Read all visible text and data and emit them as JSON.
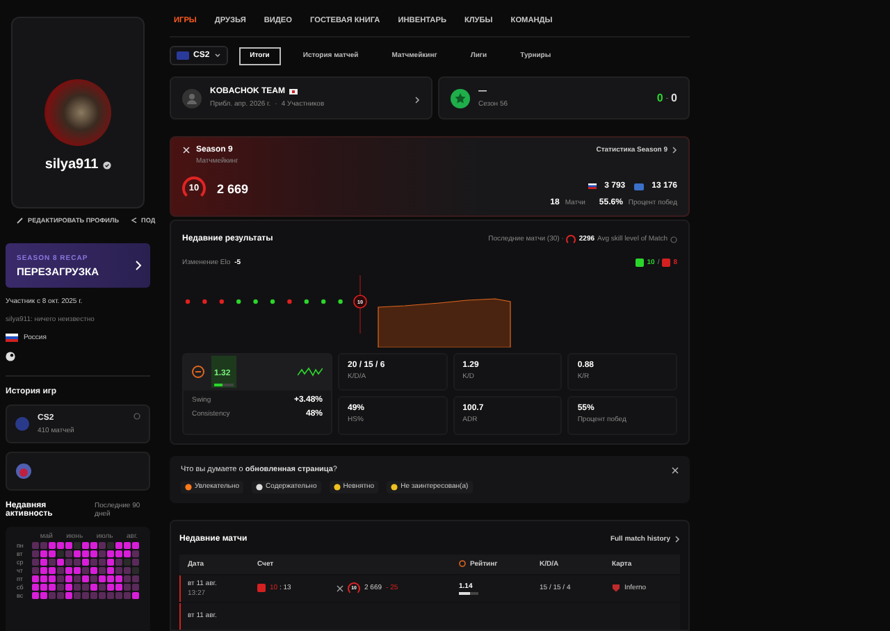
{
  "sidebar": {
    "username": "silya911",
    "actions": [
      {
        "kind": "edit",
        "label": "РЕДАКТИРОВАТЬ ПРОФИЛЬ"
      },
      {
        "kind": "share",
        "label": "ПОД"
      }
    ],
    "recap": {
      "kicker": "SEASON 8 RECAP",
      "title": "ПЕРЕЗАГРУЗКА"
    },
    "member_since": "Участник с 8 окт. 2025 г.",
    "about": "silya911: ничего неизвестно",
    "country": "Россия",
    "history_title": "История игр",
    "games": [
      {
        "name": "CS2",
        "matches": "410 матчей"
      }
    ],
    "activity": {
      "title": "Недавняя активность",
      "period": "Последние 90 дней",
      "months": [
        "май",
        "июнь",
        "июль",
        "авг."
      ],
      "days": [
        {
          "label": "пн",
          "cells": [
            {
              "color": "#5a2a5a"
            },
            {
              "color": "#5a2a5a"
            },
            {
              "color": "#d81ed8"
            },
            {
              "color": "#d81ed8"
            },
            {
              "color": "#d81ed8"
            },
            {
              "color": "#2a2a2a"
            },
            {
              "color": "#d81ed8"
            },
            {
              "color": "#d81ed8"
            },
            {
              "color": "#5a2a5a"
            },
            {
              "color": "#2a2a2a"
            },
            {
              "color": "#d81ed8"
            },
            {
              "color": "#d81ed8"
            },
            {
              "color": "#d81ed8"
            }
          ]
        },
        {
          "label": "вт",
          "cells": [
            {
              "color": "#5a2a5a"
            },
            {
              "color": "#d81ed8"
            },
            {
              "color": "#d81ed8"
            },
            {
              "color": "#2a2a2a"
            },
            {
              "color": "#5a2a5a"
            },
            {
              "color": "#d81ed8"
            },
            {
              "color": "#d81ed8"
            },
            {
              "color": "#d81ed8"
            },
            {
              "color": "#5a2a5a"
            },
            {
              "color": "#d81ed8"
            },
            {
              "color": "#d81ed8"
            },
            {
              "color": "#d81ed8"
            },
            {
              "color": "#5a2a5a"
            }
          ]
        },
        {
          "label": "ср",
          "cells": [
            {
              "color": "#5a2a5a"
            },
            {
              "color": "#d81ed8"
            },
            {
              "color": "#5a2a5a"
            },
            {
              "color": "#d81ed8"
            },
            {
              "color": "#5a2a5a"
            },
            {
              "color": "#5a2a5a"
            },
            {
              "color": "#d81ed8"
            },
            {
              "color": "#5a2a5a"
            },
            {
              "color": "#5a2a5a"
            },
            {
              "color": "#d81ed8"
            },
            {
              "color": "#5a2a5a"
            },
            {
              "color": "#2a2a2a"
            },
            {
              "color": "#5a2a5a"
            }
          ]
        },
        {
          "label": "чт",
          "cells": [
            {
              "color": "#5a2a5a"
            },
            {
              "color": "#d81ed8"
            },
            {
              "color": "#d81ed8"
            },
            {
              "color": "#5a2a5a"
            },
            {
              "color": "#d81ed8"
            },
            {
              "color": "#d81ed8"
            },
            {
              "color": "#5a2a5a"
            },
            {
              "color": "#d81ed8"
            },
            {
              "color": "#5a2a5a"
            },
            {
              "color": "#d81ed8"
            },
            {
              "color": "#5a2a5a"
            },
            {
              "color": "#5a2a5a"
            },
            {
              "color": "#2a2a2a"
            }
          ]
        },
        {
          "label": "пт",
          "cells": [
            {
              "color": "#d81ed8"
            },
            {
              "color": "#d81ed8"
            },
            {
              "color": "#d81ed8"
            },
            {
              "color": "#5a2a5a"
            },
            {
              "color": "#d81ed8"
            },
            {
              "color": "#5a2a5a"
            },
            {
              "color": "#d81ed8"
            },
            {
              "color": "#5a2a5a"
            },
            {
              "color": "#d81ed8"
            },
            {
              "color": "#d81ed8"
            },
            {
              "color": "#d81ed8"
            },
            {
              "color": "#5a2a5a"
            },
            {
              "color": "#5a2a5a"
            }
          ]
        },
        {
          "label": "сб",
          "cells": [
            {
              "color": "#d81ed8"
            },
            {
              "color": "#d81ed8"
            },
            {
              "color": "#d81ed8"
            },
            {
              "color": "#5a2a5a"
            },
            {
              "color": "#d81ed8"
            },
            {
              "color": "#5a2a5a"
            },
            {
              "color": "#5a2a5a"
            },
            {
              "color": "#d81ed8"
            },
            {
              "color": "#5a2a5a"
            },
            {
              "color": "#d81ed8"
            },
            {
              "color": "#d81ed8"
            },
            {
              "color": "#5a2a5a"
            },
            {
              "color": "#5a2a5a"
            }
          ]
        },
        {
          "label": "вс",
          "cells": [
            {
              "color": "#d81ed8"
            },
            {
              "color": "#d81ed8"
            },
            {
              "color": "#5a2a5a"
            },
            {
              "color": "#5a2a5a"
            },
            {
              "color": "#d81ed8"
            },
            {
              "color": "#5a2a5a"
            },
            {
              "color": "#5a2a5a"
            },
            {
              "color": "#5a2a5a"
            },
            {
              "color": "#5a2a5a"
            },
            {
              "color": "#5a2a5a"
            },
            {
              "color": "#5a2a5a"
            },
            {
              "color": "#5a2a5a"
            },
            {
              "color": "#d81ed8"
            }
          ]
        }
      ]
    }
  },
  "nav": [
    {
      "label": "ИГРЫ",
      "selected": true
    },
    {
      "label": "ДРУЗЬЯ",
      "selected": false
    },
    {
      "label": "ВИДЕО",
      "selected": false
    },
    {
      "label": "ГОСТЕВАЯ КНИГА",
      "selected": false
    },
    {
      "label": "ИНВЕНТАРЬ",
      "selected": false
    },
    {
      "label": "КЛУБЫ",
      "selected": false
    },
    {
      "label": "КОМАНДЫ",
      "selected": false
    }
  ],
  "game_select": {
    "value": "CS2"
  },
  "subtabs": [
    {
      "label": "Итоги",
      "selected": true
    },
    {
      "label": "История матчей",
      "selected": false
    },
    {
      "label": "Матчмейкинг",
      "selected": false
    },
    {
      "label": "Лиги",
      "selected": false
    },
    {
      "label": "Турниры",
      "selected": false
    }
  ],
  "team": {
    "name": "KOBACHOK TEAM",
    "date": "Прибл. апр. 2026 г.",
    "separator": "·",
    "members": "4 Участников"
  },
  "league": {
    "title": "—",
    "season": "Сезон 56",
    "wins": "0",
    "separator": "-",
    "losses": "0"
  },
  "season": {
    "title": "Season 9",
    "mode": "Матчмейкинг",
    "level": "10",
    "elo": "2 669",
    "stats_link": "Статистика Season 9",
    "country_rank": "3 793",
    "region_rank": "13 176",
    "matches": "18",
    "matches_label": "Матчи",
    "winrate": "55.6%",
    "winrate_label": "Процент побед"
  },
  "results": {
    "title": "Недавние результаты",
    "last_matches": "Последние матчи (30) ·",
    "avg_level": "2296",
    "avg_label": "Avg skill level of Match",
    "elo_change_label": "Изменение Elo",
    "elo_change": "-5",
    "wins": "10",
    "separator": "/",
    "losses": "8",
    "level_marker": "10",
    "dots": [
      {
        "win": false
      },
      {
        "win": false
      },
      {
        "win": false
      },
      {
        "win": true
      },
      {
        "win": true
      },
      {
        "win": true
      },
      {
        "win": false
      },
      {
        "win": true
      },
      {
        "win": true
      },
      {
        "win": true
      }
    ],
    "rating": {
      "value": "1.32",
      "level": 0.45,
      "swing_label": "Swing",
      "swing": "+3.48%",
      "consistency_label": "Consistency",
      "consistency": "48%"
    },
    "stats": [
      {
        "value": "20 / 15 / 6",
        "label": "K/D/A"
      },
      {
        "value": "1.29",
        "label": "K/D"
      },
      {
        "value": "0.88",
        "label": "K/R"
      },
      {
        "value": "49%",
        "label": "HS%"
      },
      {
        "value": "100.7",
        "label": "ADR"
      },
      {
        "value": "55%",
        "label": "Процент побед"
      }
    ]
  },
  "feedback": {
    "question": "Что вы думаете о **обновленная страница**?",
    "options": [
      {
        "kind": "fire",
        "label": "Увлекательно"
      },
      {
        "kind": "book",
        "label": "Содержательно"
      },
      {
        "kind": "confused",
        "label": "Невнятно"
      },
      {
        "kind": "meh",
        "label": "Не заинтересован(а)"
      }
    ]
  },
  "matches": {
    "title": "Недавние матчи",
    "link": "Full match history",
    "columns": [
      "Дата",
      "Счет",
      "Рейтинг",
      "K/D/A",
      "Карта"
    ],
    "rows": [
      {
        "win": false,
        "date": "вт 11 авг.",
        "time": "13:27",
        "score_own": "10",
        "score_sep": ":",
        "score_other": "13",
        "level_badge": "10",
        "elo": "2 669",
        "elo_change": "- 25",
        "rating": "1.14",
        "level": 0.6,
        "kda": "15 / 15 / 4",
        "map": "Inferno"
      },
      {
        "win": false,
        "date": "вт 11 авг."
      }
    ]
  }
}
